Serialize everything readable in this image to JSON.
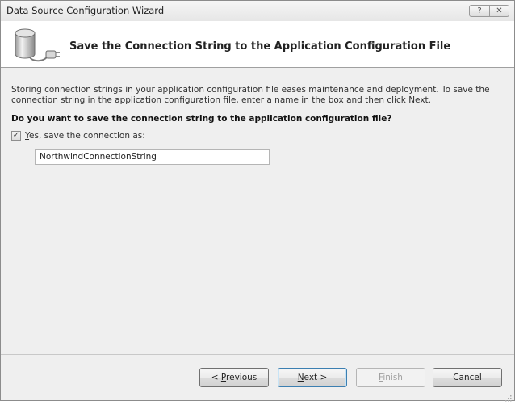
{
  "window": {
    "title": "Data Source Configuration Wizard",
    "help_glyph": "?",
    "close_glyph": "✕"
  },
  "header": {
    "title": "Save the Connection String to the Application Configuration File",
    "icon": "database-plug-icon"
  },
  "content": {
    "description": "Storing connection strings in your application configuration file eases maintenance and deployment. To save the connection string in the application configuration file, enter a name in the box and then click Next.",
    "question": "Do you want to save the connection string to the application configuration file?",
    "save_checkbox": {
      "checked": true,
      "mark": "✓",
      "label_mnemonic": "Y",
      "label_rest": "es, save the connection as:"
    },
    "connection_name_value": "NorthwindConnectionString"
  },
  "buttons": {
    "previous": {
      "prefix": "< ",
      "mnemonic": "P",
      "rest": "revious"
    },
    "next": {
      "mnemonic": "N",
      "rest": "ext >"
    },
    "finish": {
      "mnemonic": "F",
      "rest": "inish",
      "enabled": false
    },
    "cancel": {
      "label": "Cancel"
    }
  }
}
